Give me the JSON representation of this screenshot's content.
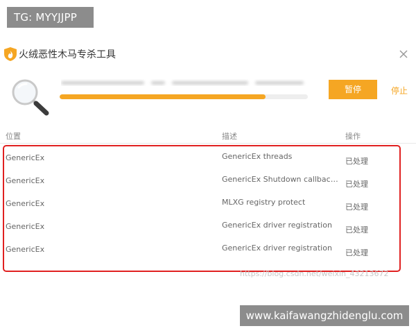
{
  "watermark_top": "TG: MYYJJPP",
  "app": {
    "title": "火绒恶性木马专杀工具"
  },
  "scan": {
    "progress_percent": 83,
    "pause_label": "暂停",
    "stop_label": "停止"
  },
  "table": {
    "headers": {
      "location": "位置",
      "description": "描述",
      "operation": "操作"
    },
    "rows": [
      {
        "location": "GenericEx",
        "description": "GenericEx threads",
        "operation": "已处理"
      },
      {
        "location": "GenericEx",
        "description": "GenericEx Shutdown callback ...",
        "operation": "已处理"
      },
      {
        "location": "GenericEx",
        "description": "MLXG registry protect",
        "operation": "已处理"
      },
      {
        "location": "GenericEx",
        "description": "GenericEx driver registration",
        "operation": "已处理"
      },
      {
        "location": "GenericEx",
        "description": "GenericEx driver registration",
        "operation": "已处理"
      }
    ]
  },
  "watermark_csdn": "https://blog.csdn.net/weixin_43213672",
  "watermark_bottom": "www.kaifawangzhidenglu.com",
  "colors": {
    "accent": "#f5a623",
    "highlight": "#e02020"
  },
  "icons": {
    "logo": "huorong-flame-shield-icon",
    "close": "close-icon",
    "scan": "magnifier-icon"
  }
}
